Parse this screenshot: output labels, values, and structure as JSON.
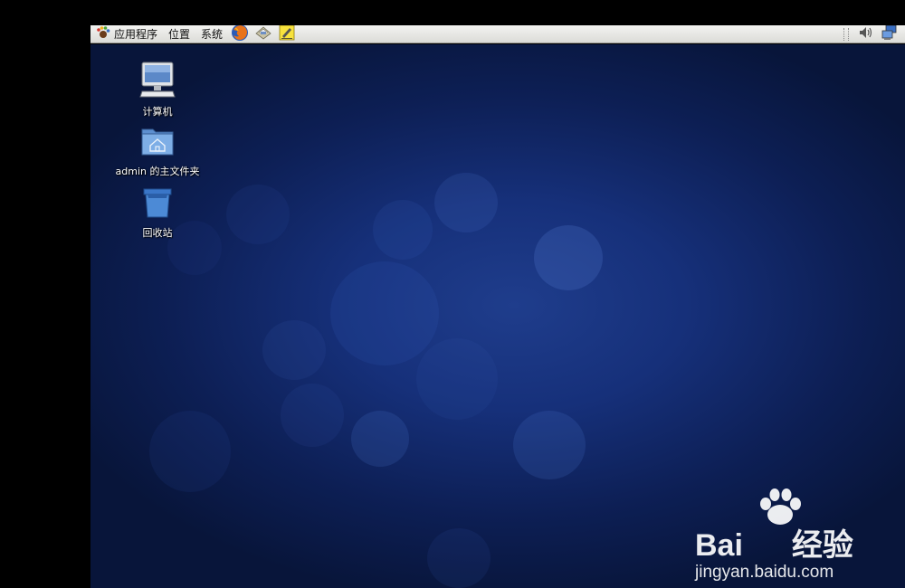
{
  "top_panel": {
    "menus": [
      {
        "label": "应用程序",
        "icon": "gnome-foot-icon"
      },
      {
        "label": "位置"
      },
      {
        "label": "系统"
      }
    ],
    "launchers": [
      "firefox-icon",
      "mail-icon",
      "notes-icon"
    ],
    "tray": [
      "volume-icon",
      "network-icon"
    ]
  },
  "desktop": {
    "icons": [
      {
        "label": "计算机",
        "icon": "computer-icon"
      },
      {
        "label": "admin 的主文件夹",
        "icon": "home-folder-icon"
      },
      {
        "label": "回收站",
        "icon": "trash-icon"
      }
    ]
  },
  "watermark": {
    "brand": "Bai",
    "brand_cn": "经验",
    "url": "jingyan.baidu.com"
  },
  "colors": {
    "desktop_center": "#1f3d8c",
    "desktop_edge": "#08153a",
    "panel_top": "#f3f3f1",
    "panel_bottom": "#dcdcd8"
  }
}
